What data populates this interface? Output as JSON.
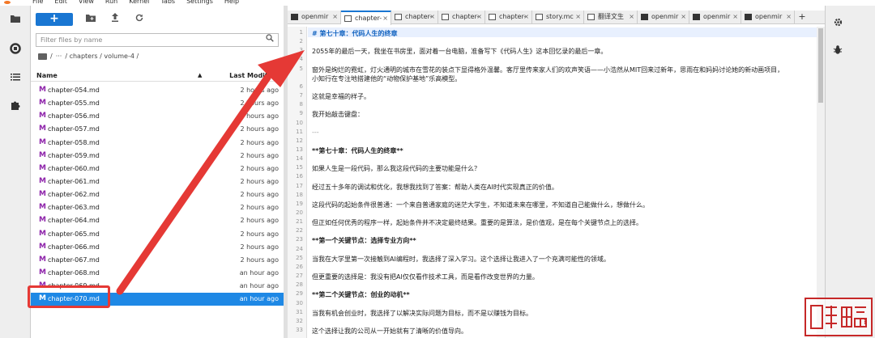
{
  "menubar": {
    "items": [
      "File",
      "Edit",
      "View",
      "Run",
      "Kernel",
      "Tabs",
      "Settings",
      "Help"
    ]
  },
  "toolbar": {
    "new_label": "+",
    "filter_placeholder": "Filter files by name"
  },
  "breadcrumb": {
    "parts": [
      "/",
      "···",
      "/ chapters / volume-4 /"
    ]
  },
  "list": {
    "name_header": "Name",
    "modified_header": "Last Modified",
    "sort_glyph": "▲",
    "files": [
      {
        "name": "chapter-054.md",
        "modified": "2 hours ago"
      },
      {
        "name": "chapter-055.md",
        "modified": "2 hours ago"
      },
      {
        "name": "chapter-056.md",
        "modified": "2 hours ago"
      },
      {
        "name": "chapter-057.md",
        "modified": "2 hours ago"
      },
      {
        "name": "chapter-058.md",
        "modified": "2 hours ago"
      },
      {
        "name": "chapter-059.md",
        "modified": "2 hours ago"
      },
      {
        "name": "chapter-060.md",
        "modified": "2 hours ago"
      },
      {
        "name": "chapter-061.md",
        "modified": "2 hours ago"
      },
      {
        "name": "chapter-062.md",
        "modified": "2 hours ago"
      },
      {
        "name": "chapter-063.md",
        "modified": "2 hours ago"
      },
      {
        "name": "chapter-064.md",
        "modified": "2 hours ago"
      },
      {
        "name": "chapter-065.md",
        "modified": "2 hours ago"
      },
      {
        "name": "chapter-066.md",
        "modified": "2 hours ago"
      },
      {
        "name": "chapter-067.md",
        "modified": "2 hours ago"
      },
      {
        "name": "chapter-068.md",
        "modified": "an hour ago"
      },
      {
        "name": "chapter-069.md",
        "modified": "an hour ago"
      },
      {
        "name": "chapter-070.md",
        "modified": "an hour ago"
      }
    ],
    "selected_index": 16
  },
  "tabs": [
    {
      "label": "openmir",
      "icon": "terminal-icon",
      "active": false
    },
    {
      "label": "chapter-",
      "icon": "document-icon",
      "active": true
    },
    {
      "label": "chapter-",
      "icon": "document-icon",
      "active": false
    },
    {
      "label": "chapter-",
      "icon": "document-icon",
      "active": false
    },
    {
      "label": "chapter-",
      "icon": "document-icon",
      "active": false
    },
    {
      "label": "story.mc",
      "icon": "document-icon",
      "active": false
    },
    {
      "label": "翻译文生",
      "icon": "document-icon",
      "active": false
    },
    {
      "label": "openmir",
      "icon": "terminal-icon",
      "active": false
    },
    {
      "label": "openmir",
      "icon": "terminal-icon",
      "active": false
    },
    {
      "label": "openmir",
      "icon": "terminal-icon",
      "active": false
    }
  ],
  "tab_close": "×",
  "tab_add": "+",
  "editor": {
    "lines": [
      {
        "n": "1",
        "text": "# 第七十章：代码人生的终章",
        "style": "h1"
      },
      {
        "n": "2",
        "text": "",
        "style": ""
      },
      {
        "n": "3",
        "text": "2055年的最后一天，我坐在书房里，面对着一台电脑，准备写下《代码人生》这本回忆录的最后一章。",
        "style": ""
      },
      {
        "n": "4",
        "text": "",
        "style": ""
      },
      {
        "n": "5",
        "text": "窗外是绚烂的霓虹，灯火通明的城市在雪花的装点下显得格外温馨。客厅里传来家人们的欢声笑语——小浩然从MIT回来过新年，思雨在和妈妈讨论她的新动画项目，",
        "style": ""
      },
      {
        "n": "",
        "text": "小知行在专注地搭建他的“动物保护基地”乐高模型。",
        "style": ""
      },
      {
        "n": "6",
        "text": "",
        "style": ""
      },
      {
        "n": "7",
        "text": "这就是幸福的样子。",
        "style": ""
      },
      {
        "n": "8",
        "text": "",
        "style": ""
      },
      {
        "n": "9",
        "text": "我开始敲击键盘：",
        "style": ""
      },
      {
        "n": "10",
        "text": "",
        "style": ""
      },
      {
        "n": "11",
        "text": "---",
        "style": "dim"
      },
      {
        "n": "12",
        "text": "",
        "style": ""
      },
      {
        "n": "13",
        "text": "**第七十章：代码人生的终章**",
        "style": "bold"
      },
      {
        "n": "14",
        "text": "",
        "style": ""
      },
      {
        "n": "15",
        "text": "如果人生是一段代码，那么我这段代码的主要功能是什么？",
        "style": ""
      },
      {
        "n": "16",
        "text": "",
        "style": ""
      },
      {
        "n": "17",
        "text": "经过五十多年的调试和优化，我想我找到了答案：帮助人类在AI时代实现真正的价值。",
        "style": ""
      },
      {
        "n": "18",
        "text": "",
        "style": ""
      },
      {
        "n": "19",
        "text": "这段代码的起始条件很普通：一个来自普通家庭的迷茫大学生，不知道未来在哪里，不知道自己能做什么，想做什么。",
        "style": ""
      },
      {
        "n": "20",
        "text": "",
        "style": ""
      },
      {
        "n": "21",
        "text": "但正如任何优秀的程序一样，起始条件并不决定最终结果。重要的是算法，是价值观，是在每个关键节点上的选择。",
        "style": ""
      },
      {
        "n": "22",
        "text": "",
        "style": ""
      },
      {
        "n": "23",
        "text": "**第一个关键节点：选择专业方向**",
        "style": "bold"
      },
      {
        "n": "24",
        "text": "",
        "style": ""
      },
      {
        "n": "25",
        "text": "当我在大学里第一次接触到AI编程时，我选择了深入学习。这个选择让我进入了一个充满可能性的领域。",
        "style": ""
      },
      {
        "n": "26",
        "text": "",
        "style": ""
      },
      {
        "n": "27",
        "text": "但更重要的选择是：我没有把AI仅仅看作技术工具，而是看作改变世界的力量。",
        "style": ""
      },
      {
        "n": "28",
        "text": "",
        "style": ""
      },
      {
        "n": "29",
        "text": "**第二个关键节点：创业的动机**",
        "style": "bold"
      },
      {
        "n": "30",
        "text": "",
        "style": ""
      },
      {
        "n": "31",
        "text": "当我有机会创业时，我选择了以解决实际问题为目标，而不是以赚钱为目标。",
        "style": ""
      },
      {
        "n": "32",
        "text": "",
        "style": ""
      },
      {
        "n": "33",
        "text": "这个选择让我的公司从一开始就有了清晰的价值导向。",
        "style": ""
      }
    ],
    "scroll_fraction": 0.24
  },
  "stamp": {
    "text": "游鳞",
    "side_text": "⁝"
  },
  "colors": {
    "accent": "#1976d2",
    "selection": "#1e88e5",
    "annotation": "#e53935",
    "md_icon": "#8e24aa"
  }
}
